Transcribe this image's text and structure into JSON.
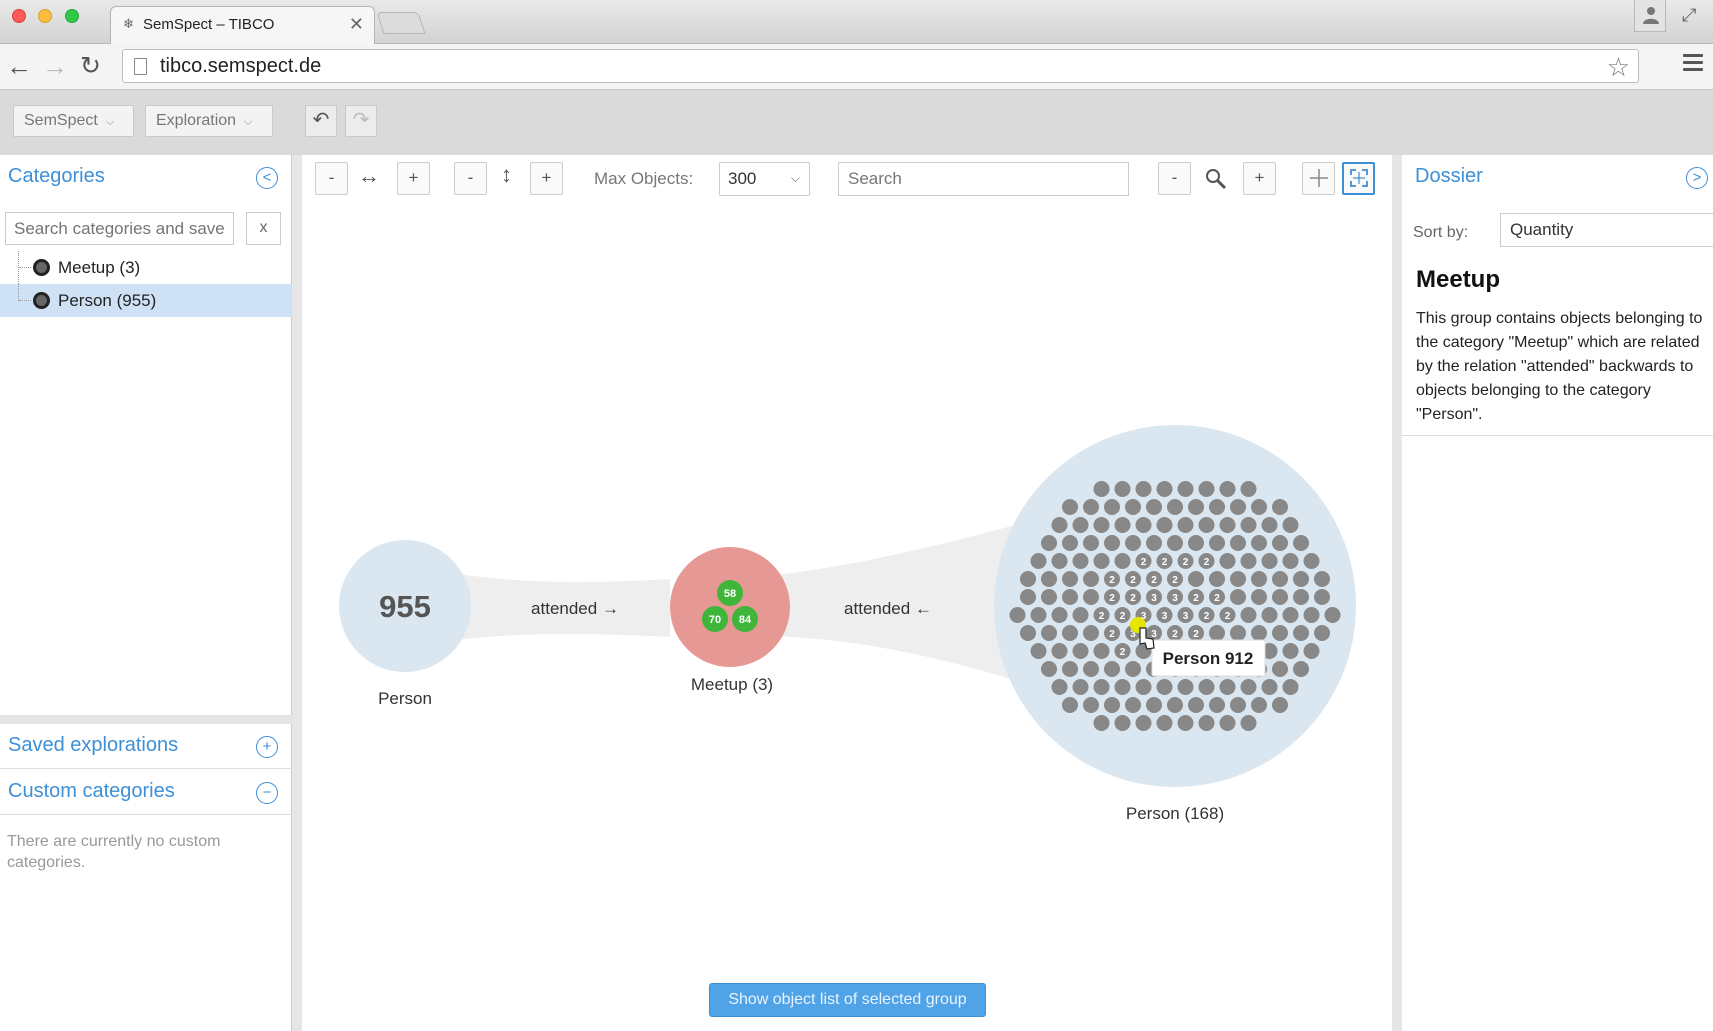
{
  "browser": {
    "tab_title": "SemSpect – TIBCO",
    "tab_close": "✕",
    "url": "tibco.semspect.de"
  },
  "app_toolbar": {
    "menu_semspect": "SemSpect",
    "menu_exploration": "Exploration"
  },
  "left_panel": {
    "categories_title": "Categories",
    "search_placeholder": "Search categories and saved",
    "clear_label": "x",
    "tree": [
      {
        "label": "Meetup (3)"
      },
      {
        "label": "Person (955)"
      }
    ],
    "saved_explorations_title": "Saved explorations",
    "custom_categories_title": "Custom categories",
    "no_custom_text": "There are currently no custom categories."
  },
  "graph_toolbar": {
    "h_minus": "-",
    "h_plus": "+",
    "v_minus": "-",
    "v_plus": "+",
    "max_objects_label": "Max Objects:",
    "max_objects_value": "300",
    "search_placeholder": "Search",
    "zoom_minus": "-",
    "zoom_plus": "+"
  },
  "graph": {
    "person_group": {
      "count": "955",
      "label": "Person"
    },
    "edge_left": "attended →",
    "meetup_group": {
      "label": "Meetup (3)",
      "members": [
        "58",
        "70",
        "84"
      ]
    },
    "edge_right": "attended ←",
    "person_168_group": {
      "label": "Person (168)"
    },
    "badge_values": {
      "row5": [
        "2",
        "2",
        "2",
        "2"
      ],
      "row6": [
        "2",
        "2",
        "2",
        "2"
      ],
      "row7": [
        "2",
        "2",
        "3",
        "3",
        "2",
        "2"
      ],
      "row8": [
        "2",
        "2",
        "3",
        "3",
        "3",
        "2",
        "2"
      ],
      "row9": [
        "2",
        "3",
        "3",
        "2",
        "2"
      ],
      "row10": [
        "2"
      ]
    },
    "tooltip": "Person 912",
    "node_color": "#888888",
    "highlight_color": "#e6e600"
  },
  "show_list_button": "Show object list of selected group",
  "right_panel": {
    "title": "Dossier",
    "sort_label": "Sort by:",
    "sort_value": "Quantity",
    "heading": "Meetup",
    "description": "This group contains objects belonging to the category \"Meetup\" which are related by the relation \"attended\" backwards to objects belonging to the category \"Person\"."
  },
  "colors": {
    "accent": "#3d8fd6",
    "group_blue": "#dbe7f0",
    "group_red": "#e69994",
    "member_green": "#3fb53a"
  }
}
